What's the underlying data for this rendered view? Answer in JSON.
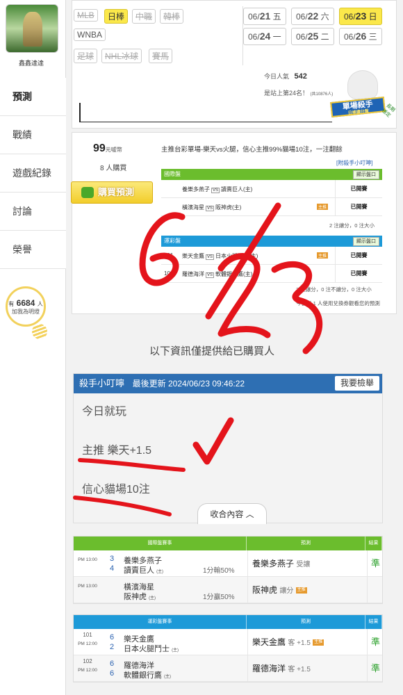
{
  "sidebar": {
    "username": "鑫鑫達達",
    "nav": [
      {
        "label": "預測"
      },
      {
        "label": "戰績"
      },
      {
        "label": "遊戲紀錄"
      },
      {
        "label": "討論"
      },
      {
        "label": "榮譽"
      }
    ],
    "fans": {
      "prefix": "有",
      "count": "6684",
      "suffix": "人",
      "label": "加我為明燈"
    }
  },
  "leagues": {
    "row1": [
      "MLB",
      "日棒",
      "中職",
      "韓棒"
    ],
    "row2": [
      "WNBA"
    ],
    "row3": [
      "足球",
      "NHL冰球",
      "賽馬"
    ]
  },
  "dates": [
    {
      "md": "06/",
      "d": "21",
      "w": "五"
    },
    {
      "md": "06/",
      "d": "22",
      "w": "六"
    },
    {
      "md": "06/",
      "d": "23",
      "w": "日"
    },
    {
      "md": "06/",
      "d": "24",
      "w": "一"
    },
    {
      "md": "06/",
      "d": "25",
      "w": "二"
    },
    {
      "md": "06/",
      "d": "26",
      "w": "三"
    }
  ],
  "popularity": {
    "label": "今日人氣",
    "value": "542",
    "rank_text": "是站上第24名！",
    "rank_note": "(共10876人)"
  },
  "badge": {
    "title": "單場殺手",
    "sub": "日棒讓分盤",
    "tag": "長期穩定"
  },
  "prediction": {
    "coins": "99",
    "coins_unit": "元噓幣",
    "buyers": "8 人購買",
    "buy_label": "購買預測",
    "desc": "主推台彩單場-樂天vs火腿，信心主推99%貓場10注，一注翻餘",
    "add_link": "[附殺手小叮嚀]",
    "intl": {
      "title": "國際盤",
      "show": "顯示盤口",
      "rows": [
        {
          "num": "",
          "away": "養樂多燕子",
          "home": "讀賣巨人(主)",
          "home_tag": "",
          "status": "已開賽"
        },
        {
          "num": "",
          "away": "橫濱海星",
          "home": "阪神虎(主)",
          "home_tag": "主推",
          "status": "已開賽"
        }
      ],
      "summary": "2 注讓分，0 注大小"
    },
    "lottery": {
      "title": "運彩盤",
      "show": "顯示盤口",
      "rows": [
        {
          "num": "101",
          "away": "樂天金鷹",
          "home": "日本火腿鬥士(主)",
          "home_tag": "主推",
          "status": "已開賽"
        },
        {
          "num": "102",
          "away": "羅德海洋",
          "home": "軟體銀行鷹(主)",
          "home_tag": "",
          "status": "已開賽"
        }
      ],
      "summary": "2 注讓分，0 注不讓分，0 注大小",
      "footnote": "今日有 1 人使用兌換券觀看您的預測"
    }
  },
  "notice": "以下資訊僅提供給已購買人",
  "tips": {
    "title": "殺手小叮嚀",
    "updated": "最後更新 2024/06/23 09:46:22",
    "report": "我要檢舉",
    "lines": [
      "今日就玩",
      "主推 樂天+1.5",
      "信心貓場10注"
    ],
    "collapse": "收合內容 ︿"
  },
  "results": [
    {
      "header": [
        "國際盤賽事",
        "預測",
        "結果"
      ],
      "color": "green",
      "rows": [
        {
          "time": "PM 13:00",
          "s1": "3",
          "s2": "4",
          "t1": "養樂多燕子",
          "t2": "讀賣巨人",
          "home_mark": "(主)",
          "odds": "1分輸50%",
          "pick": "養樂多燕子",
          "pick_note": "受讓",
          "tag": "",
          "result": "準"
        },
        {
          "time": "PM 13:00",
          "s1": "",
          "s2": "",
          "t1": "橫濱海星",
          "t2": "阪神虎",
          "home_mark": "(主)",
          "odds": "1分贏50%",
          "pick": "阪神虎",
          "pick_note": "讓分",
          "tag": "主推",
          "result": ""
        }
      ]
    },
    {
      "header": [
        "運彩盤賽事",
        "預測",
        "結果"
      ],
      "color": "blue",
      "rows": [
        {
          "num": "101",
          "time": "PM 12:00",
          "s1": "6",
          "s2": "2",
          "t1": "樂天金鷹",
          "t2": "日本火腿鬥士",
          "home_mark": "(主)",
          "odds": "",
          "pick": "樂天金鷹",
          "pick_note": "客 +1.5",
          "tag": "主推",
          "result": "準"
        },
        {
          "num": "102",
          "time": "PM 12:00",
          "s1": "6",
          "s2": "6",
          "t1": "羅德海洋",
          "t2": "軟體銀行鷹",
          "home_mark": "(主)",
          "odds": "",
          "pick": "羅德海洋",
          "pick_note": "客 +1.5",
          "tag": "",
          "result": "準"
        }
      ]
    }
  ],
  "handwriting": {
    "text": "6/23",
    "color": "#e4141b"
  },
  "colors": {
    "accent_yellow": "#fbe84a",
    "intl_green": "#6bbd2d",
    "lottery_blue": "#1d9ad8",
    "tips_blue": "#2e6fb3",
    "win_green": "#2aa02a"
  }
}
